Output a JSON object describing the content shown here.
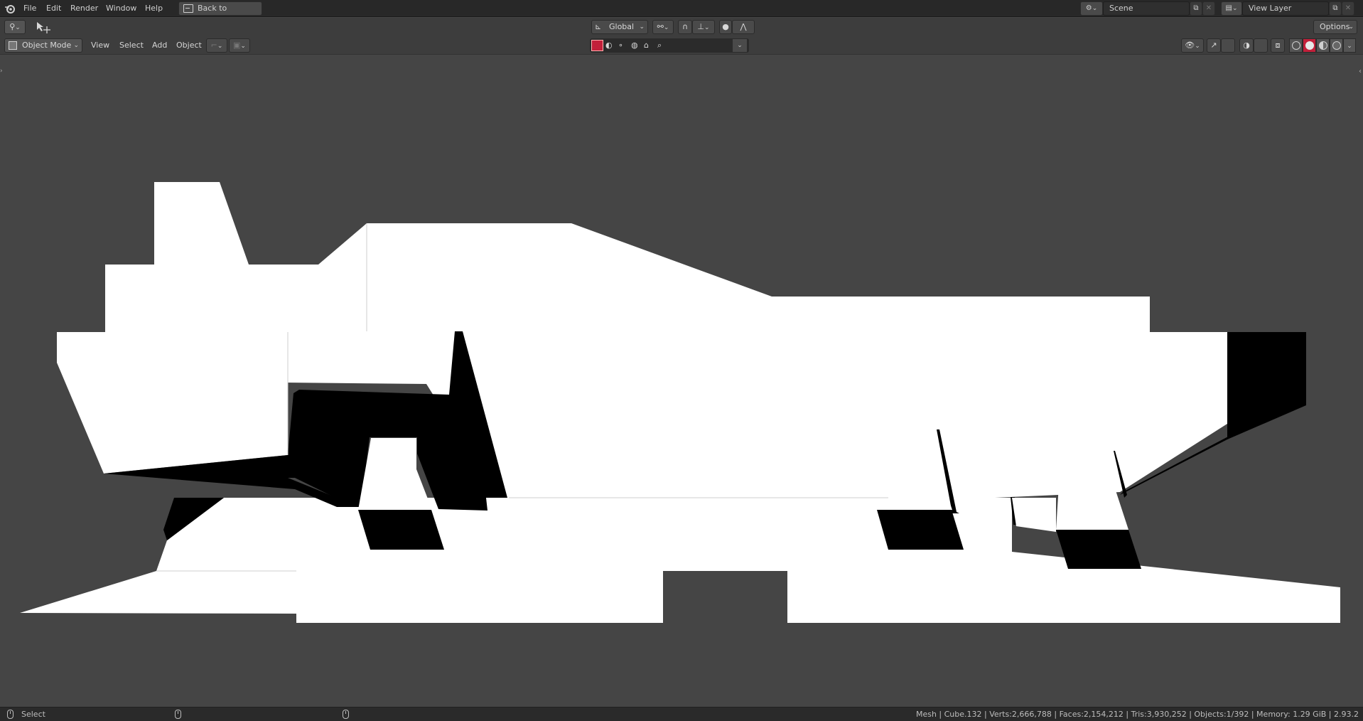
{
  "menubar": {
    "items": [
      "File",
      "Edit",
      "Render",
      "Window",
      "Help"
    ],
    "back_button": "Back to Previous",
    "scene": {
      "label": "Scene"
    },
    "view_layer": {
      "label": "View Layer"
    }
  },
  "tool_header": {
    "transform_orientation": "Global",
    "options_label": "Options"
  },
  "viewport_header": {
    "mode": "Object Mode",
    "menus": [
      "View",
      "Select",
      "Add",
      "Object"
    ],
    "search_placeholder": "",
    "active_shading": "solid"
  },
  "viewport": {
    "background_color": "#454545",
    "shadow_color": "#000000",
    "face_color": "#ffffff"
  },
  "statusbar": {
    "left_action": "Select",
    "stats": "Mesh | Cube.132 | Verts:2,666,788 | Faces:2,154,212 | Tris:3,930,252 | Objects:1/392 | Memory: 1.29 GiB | 2.93.2"
  },
  "icons": {
    "logo": "blender-logo-icon",
    "cursor_tool": "select-cursor-icon",
    "accent": "#c2203a"
  }
}
